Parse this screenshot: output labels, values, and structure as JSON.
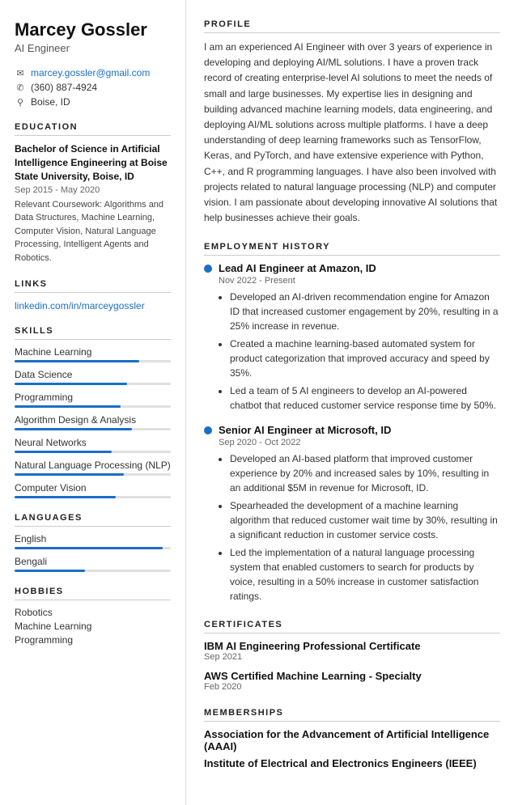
{
  "sidebar": {
    "name": "Marcey Gossler",
    "job_title": "AI Engineer",
    "contact": {
      "email": "marcey.gossler@gmail.com",
      "phone": "(360) 887-4924",
      "location": "Boise, ID"
    },
    "education": {
      "degree": "Bachelor of Science in Artificial Intelligence Engineering at Boise State University, Boise, ID",
      "date": "Sep 2015 - May 2020",
      "coursework_label": "Relevant Coursework:",
      "coursework": "Algorithms and Data Structures, Machine Learning, Computer Vision, Natural Language Processing, Intelligent Agents and Robotics."
    },
    "links": {
      "linkedin": "linkedin.com/in/marceygossler"
    },
    "skills_section_label": "SKILLS",
    "skills": [
      {
        "name": "Machine Learning",
        "pct": 80
      },
      {
        "name": "Data Science",
        "pct": 72
      },
      {
        "name": "Programming",
        "pct": 68
      },
      {
        "name": "Algorithm Design & Analysis",
        "pct": 75
      },
      {
        "name": "Neural Networks",
        "pct": 62
      },
      {
        "name": "Natural Language Processing (NLP)",
        "pct": 70
      },
      {
        "name": "Computer Vision",
        "pct": 65
      }
    ],
    "languages_section_label": "LANGUAGES",
    "languages": [
      {
        "name": "English",
        "pct": 95
      },
      {
        "name": "Bengali",
        "pct": 45
      }
    ],
    "hobbies_section_label": "HOBBIES",
    "hobbies": [
      "Robotics",
      "Machine Learning",
      "Programming"
    ]
  },
  "main": {
    "profile_section_label": "PROFILE",
    "profile_text": "I am an experienced AI Engineer with over 3 years of experience in developing and deploying AI/ML solutions. I have a proven track record of creating enterprise-level AI solutions to meet the needs of small and large businesses. My expertise lies in designing and building advanced machine learning models, data engineering, and deploying AI/ML solutions across multiple platforms. I have a deep understanding of deep learning frameworks such as TensorFlow, Keras, and PyTorch, and have extensive experience with Python, C++, and R programming languages. I have also been involved with projects related to natural language processing (NLP) and computer vision. I am passionate about developing innovative AI solutions that help businesses achieve their goals.",
    "employment_section_label": "EMPLOYMENT HISTORY",
    "jobs": [
      {
        "title": "Lead AI Engineer at Amazon, ID",
        "date": "Nov 2022 - Present",
        "bullets": [
          "Developed an AI-driven recommendation engine for Amazon ID that increased customer engagement by 20%, resulting in a 25% increase in revenue.",
          "Created a machine learning-based automated system for product categorization that improved accuracy and speed by 35%.",
          "Led a team of 5 AI engineers to develop an AI-powered chatbot that reduced customer service response time by 50%."
        ]
      },
      {
        "title": "Senior AI Engineer at Microsoft, ID",
        "date": "Sep 2020 - Oct 2022",
        "bullets": [
          "Developed an AI-based platform that improved customer experience by 20% and increased sales by 10%, resulting in an additional $5M in revenue for Microsoft, ID.",
          "Spearheaded the development of a machine learning algorithm that reduced customer wait time by 30%, resulting in a significant reduction in customer service costs.",
          "Led the implementation of a natural language processing system that enabled customers to search for products by voice, resulting in a 50% increase in customer satisfaction ratings."
        ]
      }
    ],
    "certificates_section_label": "CERTIFICATES",
    "certificates": [
      {
        "name": "IBM AI Engineering Professional Certificate",
        "date": "Sep 2021"
      },
      {
        "name": "AWS Certified Machine Learning - Specialty",
        "date": "Feb 2020"
      }
    ],
    "memberships_section_label": "MEMBERSHIPS",
    "memberships": [
      "Association for the Advancement of Artificial Intelligence (AAAI)",
      "Institute of Electrical and Electronics Engineers (IEEE)"
    ]
  }
}
